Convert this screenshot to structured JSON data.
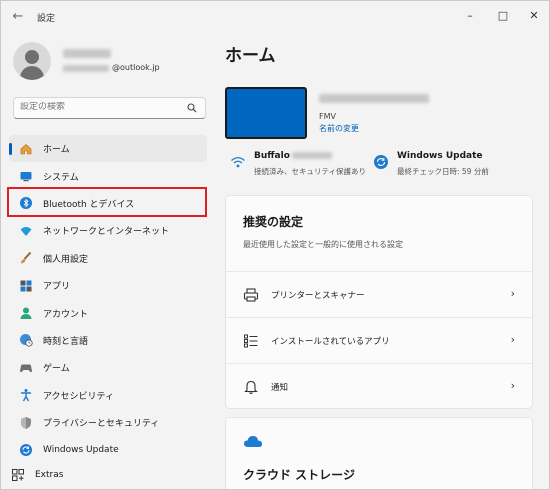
{
  "window": {
    "title": "設定",
    "back_glyph": "←",
    "min_glyph": "–",
    "max_glyph": "□",
    "close_glyph": "✕"
  },
  "profile": {
    "email_domain": "@outlook.jp"
  },
  "search": {
    "placeholder": "設定の検索"
  },
  "nav": {
    "items": [
      {
        "label": "ホーム",
        "icon": "home-icon"
      },
      {
        "label": "システム",
        "icon": "system-icon"
      },
      {
        "label": "Bluetooth とデバイス",
        "icon": "bluetooth-icon"
      },
      {
        "label": "ネットワークとインターネット",
        "icon": "wifi-icon"
      },
      {
        "label": "個人用設定",
        "icon": "brush-icon"
      },
      {
        "label": "アプリ",
        "icon": "apps-icon"
      },
      {
        "label": "アカウント",
        "icon": "account-icon"
      },
      {
        "label": "時刻と言語",
        "icon": "globe-clock-icon"
      },
      {
        "label": "ゲーム",
        "icon": "gamepad-icon"
      },
      {
        "label": "アクセシビリティ",
        "icon": "accessibility-icon"
      },
      {
        "label": "プライバシーとセキュリティ",
        "icon": "shield-icon"
      },
      {
        "label": "Windows Update",
        "icon": "update-icon"
      }
    ],
    "extras": {
      "label": "Extras",
      "icon": "extras-icon"
    },
    "active_index": 0,
    "highlighted_index": 2
  },
  "main": {
    "title": "ホーム",
    "device": {
      "model": "FMV",
      "rename_label": "名前の変更"
    },
    "wifi": {
      "name_prefix": "Buffalo",
      "status": "接続済み、セキュリティ保護あり"
    },
    "update": {
      "title": "Windows Update",
      "status": "最終チェック日時: 59 分前"
    },
    "recommended": {
      "title": "推奨の設定",
      "subtitle": "最近使用した設定と一般的に使用される設定",
      "rows": [
        {
          "label": "プリンターとスキャナー",
          "icon": "printer-icon"
        },
        {
          "label": "インストールされているアプリ",
          "icon": "app-list-icon"
        },
        {
          "label": "通知",
          "icon": "bell-icon"
        }
      ],
      "chevron": "›"
    },
    "cloud": {
      "title": "クラウド ストレージ"
    }
  },
  "colors": {
    "accent": "#005fb8",
    "device_fill": "#0067c0",
    "highlight": "#e02020"
  }
}
